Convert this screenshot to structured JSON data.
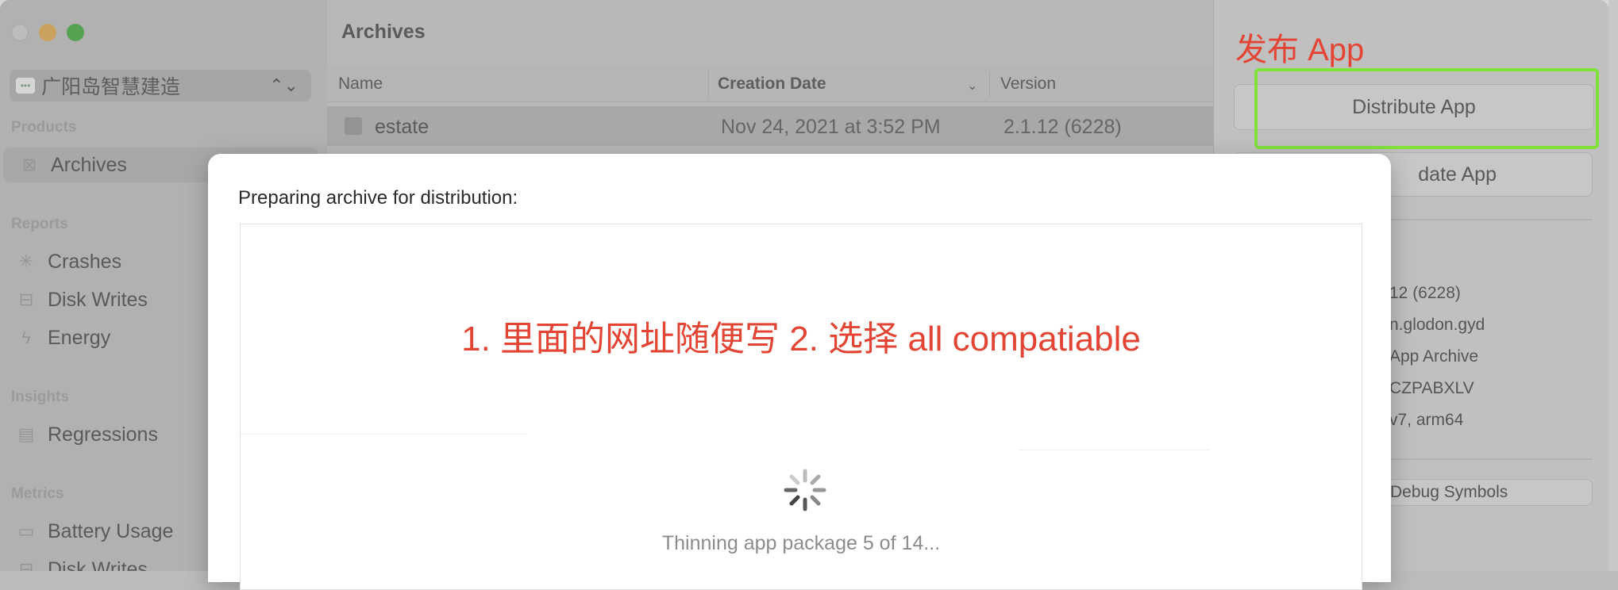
{
  "sidebar": {
    "team_name": "广阳岛智慧建造",
    "sections": {
      "products": "Products",
      "reports": "Reports",
      "insights": "Insights",
      "metrics": "Metrics"
    },
    "items": {
      "archives": "Archives",
      "crashes": "Crashes",
      "disk_writes": "Disk Writes",
      "energy": "Energy",
      "regressions": "Regressions",
      "battery_usage": "Battery Usage",
      "disk_writes_metrics": "Disk Writes"
    }
  },
  "archives": {
    "title": "Archives",
    "columns": {
      "name": "Name",
      "creation_date": "Creation Date",
      "version": "Version"
    },
    "rows": [
      {
        "name": "estate",
        "creation_date": "Nov 24, 2021 at 3:52 PM",
        "version": "2.1.12 (6228)"
      }
    ]
  },
  "inspector": {
    "annotation": "发布 App",
    "distribute_label": "Distribute App",
    "validate_label_visible": "date App",
    "details": [
      "12 (6228)",
      "n.glodon.gyd",
      "App Archive",
      "CZPABXLV",
      "v7, arm64"
    ],
    "debug_symbols_label": "Debug Symbols"
  },
  "sheet": {
    "title": "Preparing archive for distribution:",
    "annotation": "1. 里面的网址随便写 2. 选择 all compatiable",
    "status": "Thinning app package 5 of 14..."
  },
  "colors": {
    "annotation_red": "#e34534",
    "highlight_green": "#7ee23a"
  }
}
